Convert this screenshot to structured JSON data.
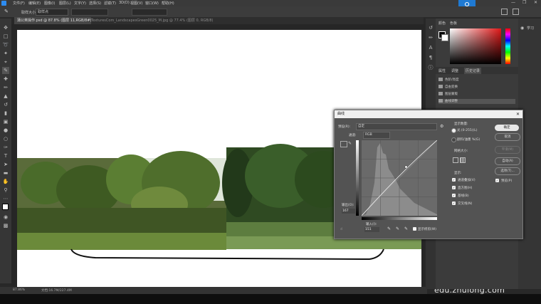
{
  "menu": [
    "文件(F)",
    "编辑(E)",
    "图像(I)",
    "图层(L)",
    "文字(Y)",
    "选择(S)",
    "滤镜(T)",
    "3D(D)",
    "视图(V)",
    "窗口(W)",
    "帮助(H)"
  ],
  "options": {
    "sample_label": "取样大小:",
    "sample_value": "取样点"
  },
  "tabs": [
    {
      "label": "蒲公英操作.psd @ 87.8% (图层 11,RGB/8#) *",
      "active": true
    },
    {
      "label": "TexturesCom_LandscapesGreen0025_M.jpg @ 77.4% (图层 0, RGB/8)",
      "active": false
    }
  ],
  "status": {
    "zoom": "87.86%",
    "doc": "文档:16.7M/227.4M"
  },
  "watermark": "edu.zhulong.com",
  "right_panel": {
    "color_tabs": [
      "颜色",
      "色板"
    ],
    "tabs": [
      "属性",
      "调整",
      "历史记录"
    ],
    "history": [
      "色阶/亮度",
      "自由变换",
      "图层蒙版",
      "曲线调整"
    ],
    "learn": "学习"
  },
  "curves": {
    "title": "曲线",
    "preset_label": "预设(R):",
    "preset_value": "自定",
    "channel_label": "通道:",
    "channel_value": "RGB",
    "output_label": "输出(O):",
    "output_value": "167",
    "input_label": "输入(I):",
    "input_value": "151",
    "show_amount": "显示数量:",
    "light_option": "光 (0-255)(L)",
    "pigment_option": "颜料/油墨 %(G)",
    "grid_size": "网格大小:",
    "show": "显示:",
    "checks": [
      "通道叠加(V)",
      "直方图(H)",
      "基线(B)",
      "交叉线(N)"
    ],
    "ok": "确定",
    "cancel": "取消",
    "smooth": "平滑(M)",
    "auto": "自动(A)",
    "options": "选项(T)...",
    "preview": "预览(P)",
    "show_clipping": "显示修剪(W)"
  },
  "colors": {
    "accent": "#1f7ad3",
    "hue_red": "#e01818"
  }
}
